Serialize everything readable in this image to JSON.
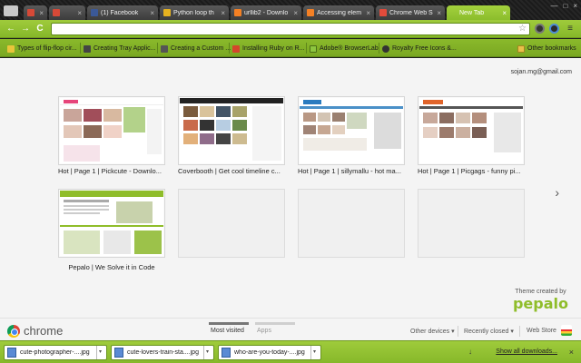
{
  "colors": {
    "accent": "#8fbd2a",
    "tab_active": "#9ccb3b",
    "content_bg": "#f4f4f4"
  },
  "tabs": [
    {
      "title": "",
      "favicon": "gmail-icon",
      "favicon_color": "#d64937"
    },
    {
      "title": "",
      "favicon": "gmail-icon",
      "favicon_color": "#d64937"
    },
    {
      "title": "(1) Facebook",
      "favicon": "facebook-icon",
      "favicon_color": "#3b5998"
    },
    {
      "title": "Python loop th",
      "favicon": "python-icon",
      "favicon_color": "#e6b21f"
    },
    {
      "title": "urllib2 - Downlo",
      "favicon": "stackoverflow-icon",
      "favicon_color": "#f48024"
    },
    {
      "title": "Accessing elem",
      "favicon": "stackoverflow-icon",
      "favicon_color": "#f48024"
    },
    {
      "title": "Chrome Web S",
      "favicon": "webstore-icon",
      "favicon_color": "#e34b3b"
    },
    {
      "title": "New Tab",
      "favicon": "",
      "favicon_color": ""
    }
  ],
  "bookmarks": [
    {
      "label": "Types of flip-flop cir...",
      "icon": "page-icon",
      "color": "#e8c53a"
    },
    {
      "label": "Creating Tray Applic...",
      "icon": "page-icon",
      "color": "#444"
    },
    {
      "label": "Creating a Custom ...",
      "icon": "page-icon",
      "color": "#555"
    },
    {
      "label": "Installing Ruby on R...",
      "icon": "ruby-icon",
      "color": "#d4452b"
    },
    {
      "label": "Adobe® BrowserLab",
      "icon": "adobe-icon",
      "color": "#8dc63f"
    },
    {
      "label": "Royalty Free Icons &...",
      "icon": "user-icon",
      "color": "#333"
    }
  ],
  "other_bookmarks": "Other bookmarks",
  "user_email": "sojan.mg@gmail.com",
  "tiles": [
    {
      "caption": "Hot | Page 1 | Pickcute - Downlo...",
      "empty": false
    },
    {
      "caption": "Coverbooth | Get cool timeline c...",
      "empty": false
    },
    {
      "caption": "Hot | Page 1 | sillymallu - hot ma...",
      "empty": false
    },
    {
      "caption": "Hot | Page 1 | Picgags - funny pi...",
      "empty": false
    },
    {
      "caption": "Pepalo | We Solve it in Code",
      "empty": false
    },
    {
      "caption": "",
      "empty": true
    },
    {
      "caption": "",
      "empty": true
    },
    {
      "caption": "",
      "empty": true
    }
  ],
  "next_arrow": "›",
  "credits": {
    "label": "Theme created by",
    "logo": "pepalo"
  },
  "footer": {
    "brand": "chrome",
    "most_visited": "Most visited",
    "apps": "Apps",
    "other_devices": "Other devices",
    "recently_closed": "Recently closed",
    "web_store": "Web Store"
  },
  "downloads": [
    {
      "name": "cute-photographer-....jpg"
    },
    {
      "name": "cute-lovers-train-sta....jpg"
    },
    {
      "name": "who-are-you-today-....jpg"
    }
  ],
  "show_all_downloads": "Show all downloads...",
  "glyphs": {
    "back": "←",
    "forward": "→",
    "reload": "C",
    "star": "☆",
    "close": "×",
    "menu": "≡",
    "minimize": "—",
    "maximize": "□",
    "dropdown": "▾",
    "download_arrow": "↓"
  }
}
